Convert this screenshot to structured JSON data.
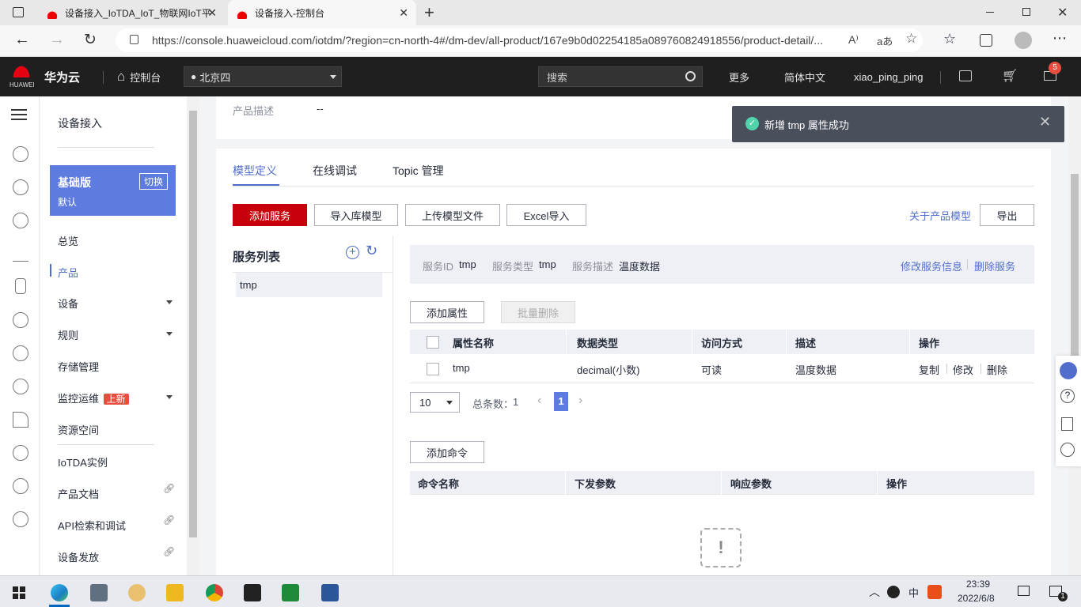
{
  "browser": {
    "tabs": [
      {
        "title": "设备接入_IoTDA_IoT_物联网IoT平"
      },
      {
        "title": "设备接入-控制台"
      }
    ],
    "new_tab": "+",
    "url": "https://console.huaweicloud.com/iotdm/?region=cn-north-4#/dm-dev/all-product/167e9b0d02254185a089760824918556/product-detail/...",
    "read_aloud": "A⁾",
    "translate": "aあ"
  },
  "header": {
    "logo_text": "HUAWEI",
    "brand": "华为云",
    "console": "控制台",
    "region": "北京四",
    "search_placeholder": "搜索",
    "more": "更多",
    "language": "简体中文",
    "user": "xiao_ping_ping",
    "notification_count": "5"
  },
  "sidenav": {
    "title": "设备接入",
    "edition": {
      "name": "基础版",
      "sub": "默认",
      "switch": "切换"
    },
    "items": [
      {
        "label": "总览"
      },
      {
        "label": "产品"
      },
      {
        "label": "设备"
      },
      {
        "label": "规则"
      },
      {
        "label": "存储管理"
      },
      {
        "label": "监控运维"
      },
      {
        "label": "资源空间"
      },
      {
        "label": "IoTDA实例"
      },
      {
        "label": "产品文档"
      },
      {
        "label": "API检索和调试"
      },
      {
        "label": "设备发放"
      }
    ],
    "new_badge": "上新"
  },
  "product": {
    "desc_label": "产品描述",
    "desc_value": "--"
  },
  "tabs": [
    {
      "label": "模型定义"
    },
    {
      "label": "在线调试"
    },
    {
      "label": "Topic 管理"
    }
  ],
  "toolbar": {
    "add_service": "添加服务",
    "import_lib": "导入库模型",
    "upload_file": "上传模型文件",
    "excel_import": "Excel导入",
    "about_model": "关于产品模型",
    "export": "导出"
  },
  "service_list": {
    "title": "服务列表",
    "items": [
      {
        "name": "tmp"
      }
    ]
  },
  "service_info": {
    "id_label": "服务ID",
    "id_value": "tmp",
    "type_label": "服务类型",
    "type_value": "tmp",
    "desc_label": "服务描述",
    "desc_value": "温度数据",
    "edit": "修改服务信息",
    "delete": "删除服务"
  },
  "properties": {
    "add": "添加属性",
    "batch_delete": "批量删除",
    "headers": [
      "属性名称",
      "数据类型",
      "访问方式",
      "描述",
      "操作"
    ],
    "rows": [
      {
        "name": "tmp",
        "type": "decimal(小数)",
        "access": "可读",
        "desc": "温度数据",
        "copy": "复制",
        "edit": "修改",
        "delete": "删除"
      }
    ],
    "page_size": "10",
    "total_label": "总条数：",
    "total": "1",
    "current_page": "1"
  },
  "commands": {
    "add": "添加命令",
    "headers": [
      "命令名称",
      "下发参数",
      "响应参数",
      "操作"
    ]
  },
  "toast": {
    "message": "新增 tmp 属性成功"
  },
  "taskbar": {
    "time": "23:39",
    "date": "2022/6/8",
    "ime": "中",
    "notif_count": "1"
  }
}
